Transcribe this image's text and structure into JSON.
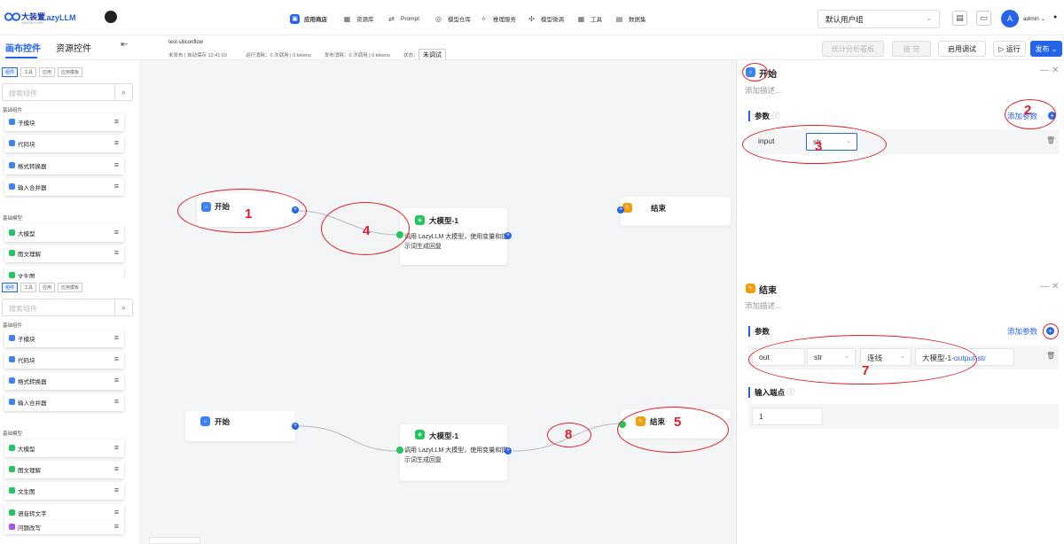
{
  "topbar": {
    "logo_text": "大装置",
    "logo_sub": "SENSECORE",
    "brand": "LazyLLM",
    "nav": [
      {
        "label": "应用商店",
        "icon": "store-icon"
      },
      {
        "label": "资源库",
        "icon": "grid-icon"
      },
      {
        "label": "Prompt",
        "icon": "prompt-icon"
      },
      {
        "label": "模型仓库",
        "icon": "cube-icon"
      },
      {
        "label": "推理服务",
        "icon": "inference-icon"
      },
      {
        "label": "模型微调",
        "icon": "finetune-icon"
      },
      {
        "label": "工具",
        "icon": "tool-icon"
      },
      {
        "label": "数据集",
        "icon": "dataset-icon"
      }
    ],
    "user_group": "默认用户组",
    "avatar_letter": "A",
    "username": "admin",
    "accent": "#2563eb"
  },
  "subbar": {
    "tab_canvas": "画布控件",
    "tab_resource": "资源控件",
    "project_name": "test-siliconflow",
    "publish_state": "未发布 | 自动保存 12:41:03",
    "run_cost": "运行消耗：0 次调用 | 0 tokens",
    "pub_cost": "发布消耗：0 次调用 | 0 tokens",
    "status_label": "状态：",
    "status_value": "未调试",
    "btn_stats": "统计分析看板",
    "btn_publish_disabled": "接 觉",
    "btn_debug": "启用调试",
    "btn_run": "运行",
    "btn_publish": "发布"
  },
  "left_panel": {
    "chips": [
      "组件",
      "工具",
      "应用",
      "应用模板"
    ],
    "search_placeholder": "搜索组件",
    "section_basic": "基础组件",
    "basic_items": [
      "子模块",
      "代码块",
      "格式转换器",
      "输入合并器"
    ],
    "section_model": "基础模型",
    "model_items_top": [
      "大模型",
      "图文理解",
      "文生图"
    ],
    "model_items_bottom": [
      "大模型",
      "图文理解",
      "文生图",
      "语音转文字",
      "问题改写"
    ]
  },
  "canvas": {
    "start_label": "开始",
    "llm_label": "大模型-1",
    "llm_desc": "调用 LazyLLM 大模型，使用变量和提示词生成回复",
    "end_label": "结束"
  },
  "start_panel": {
    "title": "开始",
    "desc_placeholder": "添加描述...",
    "section": "参数",
    "add_param": "添加参数",
    "param_name": "input",
    "param_type": "str"
  },
  "end_panel": {
    "title": "结束",
    "desc_placeholder": "添加描述...",
    "section": "参数",
    "add_param": "添加参数",
    "param_name": "out",
    "param_type": "str",
    "param_mode": "连线",
    "param_source_prefix": "大模型-1-",
    "param_source_suffix": "output-str",
    "section_ports": "输入端点",
    "ports_value": "1"
  },
  "annotations": [
    "1",
    "2",
    "3",
    "4",
    "5",
    "7",
    "8"
  ]
}
